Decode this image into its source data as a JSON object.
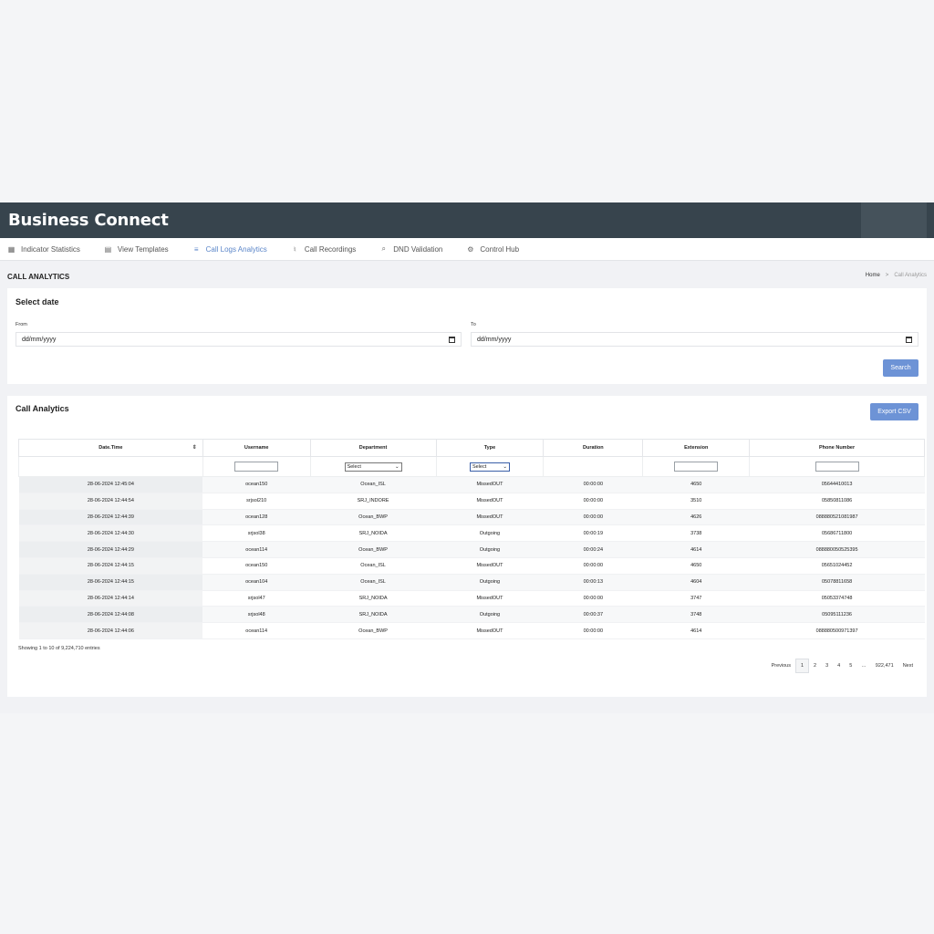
{
  "app": {
    "brand": "Business Connect"
  },
  "nav": [
    {
      "label": "Indicator Statistics",
      "icon": "grid-icon",
      "glyph": "▦",
      "active": false
    },
    {
      "label": "View Templates",
      "icon": "document-icon",
      "glyph": "▤",
      "active": false
    },
    {
      "label": "Call Logs Analytics",
      "icon": "list-icon",
      "glyph": "≡",
      "active": true
    },
    {
      "label": "Call Recordings",
      "icon": "microphone-icon",
      "glyph": "♮",
      "active": false
    },
    {
      "label": "DND Validation",
      "icon": "search-icon",
      "glyph": "⌕",
      "active": false
    },
    {
      "label": "Control Hub",
      "icon": "gear-icon",
      "glyph": "⚙",
      "active": false
    }
  ],
  "page": {
    "title": "CALL ANALYTICS"
  },
  "breadcrumb": {
    "home": "Home",
    "separator": ">",
    "current": "Call Analytics"
  },
  "date_card": {
    "title": "Select date",
    "from_label": "From",
    "from_value": "dd/mm/yyyy",
    "to_label": "To",
    "to_value": "dd/mm/yyyy",
    "search_label": "Search"
  },
  "analytics_card": {
    "title": "Call Analytics",
    "export_label": "Export CSV",
    "columns": [
      "Date.Time",
      "Username",
      "Department",
      "Type",
      "Duration",
      "Extension",
      "Phone Number"
    ],
    "department_filter": "Select",
    "type_filter": "Select",
    "rows": [
      [
        "28-06-2024 12:45:04",
        "ocean150",
        "Ocean_ISL",
        "MissedOUT",
        "00:00:00",
        "4650",
        "05644410013"
      ],
      [
        "28-06-2024 12:44:54",
        "srjsol210",
        "SRJ_INDORE",
        "MissedOUT",
        "00:00:00",
        "3510",
        "05850811086"
      ],
      [
        "28-06-2024 12:44:39",
        "ocean128",
        "Ocean_BWP",
        "MissedOUT",
        "00:00:00",
        "4626",
        "088880521081987"
      ],
      [
        "28-06-2024 12:44:30",
        "srjsol38",
        "SRJ_NOIDA",
        "Outgoing",
        "00:00:19",
        "3738",
        "05686711800"
      ],
      [
        "28-06-2024 12:44:29",
        "ocean114",
        "Ocean_BWP",
        "Outgoing",
        "00:00:24",
        "4614",
        "088880050525395"
      ],
      [
        "28-06-2024 12:44:15",
        "ocean150",
        "Ocean_ISL",
        "MissedOUT",
        "00:00:00",
        "4650",
        "05651024452"
      ],
      [
        "28-06-2024 12:44:15",
        "ocean104",
        "Ocean_ISL",
        "Outgoing",
        "00:00:13",
        "4604",
        "05078811658"
      ],
      [
        "28-06-2024 12:44:14",
        "srjsol47",
        "SRJ_NOIDA",
        "MissedOUT",
        "00:00:00",
        "3747",
        "05053374748"
      ],
      [
        "28-06-2024 12:44:08",
        "srjsol48",
        "SRJ_NOIDA",
        "Outgoing",
        "00:00:37",
        "3748",
        "05095111236"
      ],
      [
        "28-06-2024 12:44:06",
        "ocean114",
        "Ocean_BWP",
        "MissedOUT",
        "00:00:00",
        "4614",
        "088880500971397"
      ]
    ],
    "info": "Showing 1 to 10 of 9,224,710 entries",
    "pagination": {
      "previous": "Previous",
      "pages": [
        "1",
        "2",
        "3",
        "4",
        "5"
      ],
      "ellipsis": "…",
      "last": "922,471",
      "next": "Next",
      "current": "1"
    }
  }
}
